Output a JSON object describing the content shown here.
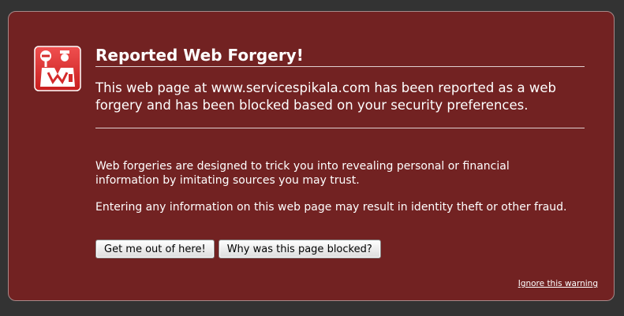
{
  "error": {
    "icon": "police-officer-alert-icon",
    "title": "Reported Web Forgery!",
    "short_desc": "This web page at www.servicespikala.com has been reported as a web forgery and has been blocked based on your security preferences.",
    "long_desc": [
      "Web forgeries are designed to trick you into revealing personal or financial information by imitating sources you may trust.",
      "Entering any information on this web page may result in identity theft or other fraud."
    ],
    "buttons": {
      "get_me_out": "Get me out of here!",
      "why_blocked": "Why was this page blocked?"
    },
    "ignore_link": "Ignore this warning"
  },
  "colors": {
    "page_background": "#333333",
    "panel_background": "#722222",
    "icon_red": "#d42a2a"
  }
}
